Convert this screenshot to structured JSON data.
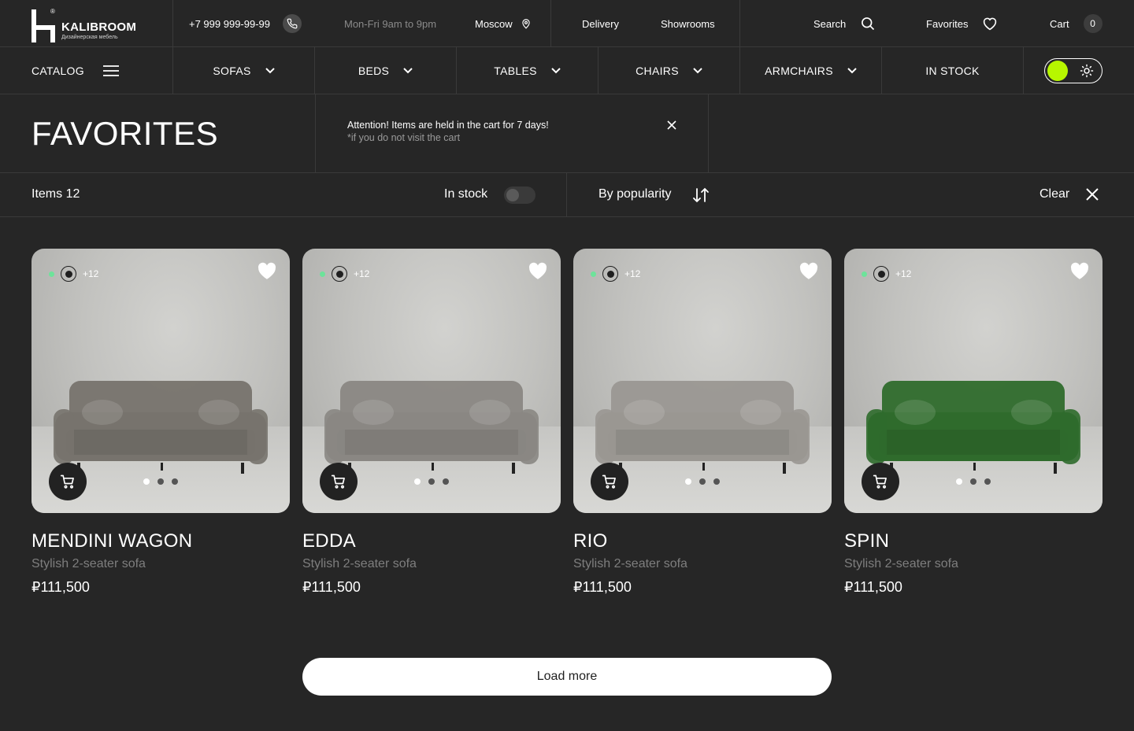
{
  "brand": {
    "name": "KALIBROOM",
    "tagline": "Дизайнерская мебель",
    "registered": "®"
  },
  "topbar": {
    "phone": "+7 999 999-99-99",
    "hours": "Mon-Fri 9am to 9pm",
    "city": "Moscow",
    "delivery": "Delivery",
    "showrooms": "Showrooms",
    "search": "Search",
    "favorites": "Favorites",
    "cart": "Cart",
    "cart_count": "0"
  },
  "nav": {
    "catalog": "CATALOG",
    "items": [
      "SOFAS",
      "BEDS",
      "TABLES",
      "CHAIRS",
      "ARMCHAIRS"
    ],
    "in_stock": "IN STOCK",
    "theme_accent": "#b7f700"
  },
  "page": {
    "title": "FAVORITES",
    "notice_main": "Attention! Items are held in the cart for 7 days!",
    "notice_sub": "*if you do not visit the cart"
  },
  "filters": {
    "items_count": "Items 12",
    "in_stock": "In stock",
    "sort": "By popularity",
    "clear": "Clear"
  },
  "products": [
    {
      "name": "MENDINI WAGON",
      "desc": "Stylish 2-seater sofa",
      "price": "₽111,500",
      "more_colors": "+12",
      "sofa_color": "#77736d"
    },
    {
      "name": "EDDA",
      "desc": "Stylish 2-seater sofa",
      "price": "₽111,500",
      "more_colors": "+12",
      "sofa_color": "#8a8783"
    },
    {
      "name": "RIO",
      "desc": "Stylish 2-seater sofa",
      "price": "₽111,500",
      "more_colors": "+12",
      "sofa_color": "#9a9792"
    },
    {
      "name": "SPIN",
      "desc": "Stylish 2-seater sofa",
      "price": "₽111,500",
      "more_colors": "+12",
      "sofa_color": "#2f6b2c"
    }
  ],
  "load_more": "Load more"
}
